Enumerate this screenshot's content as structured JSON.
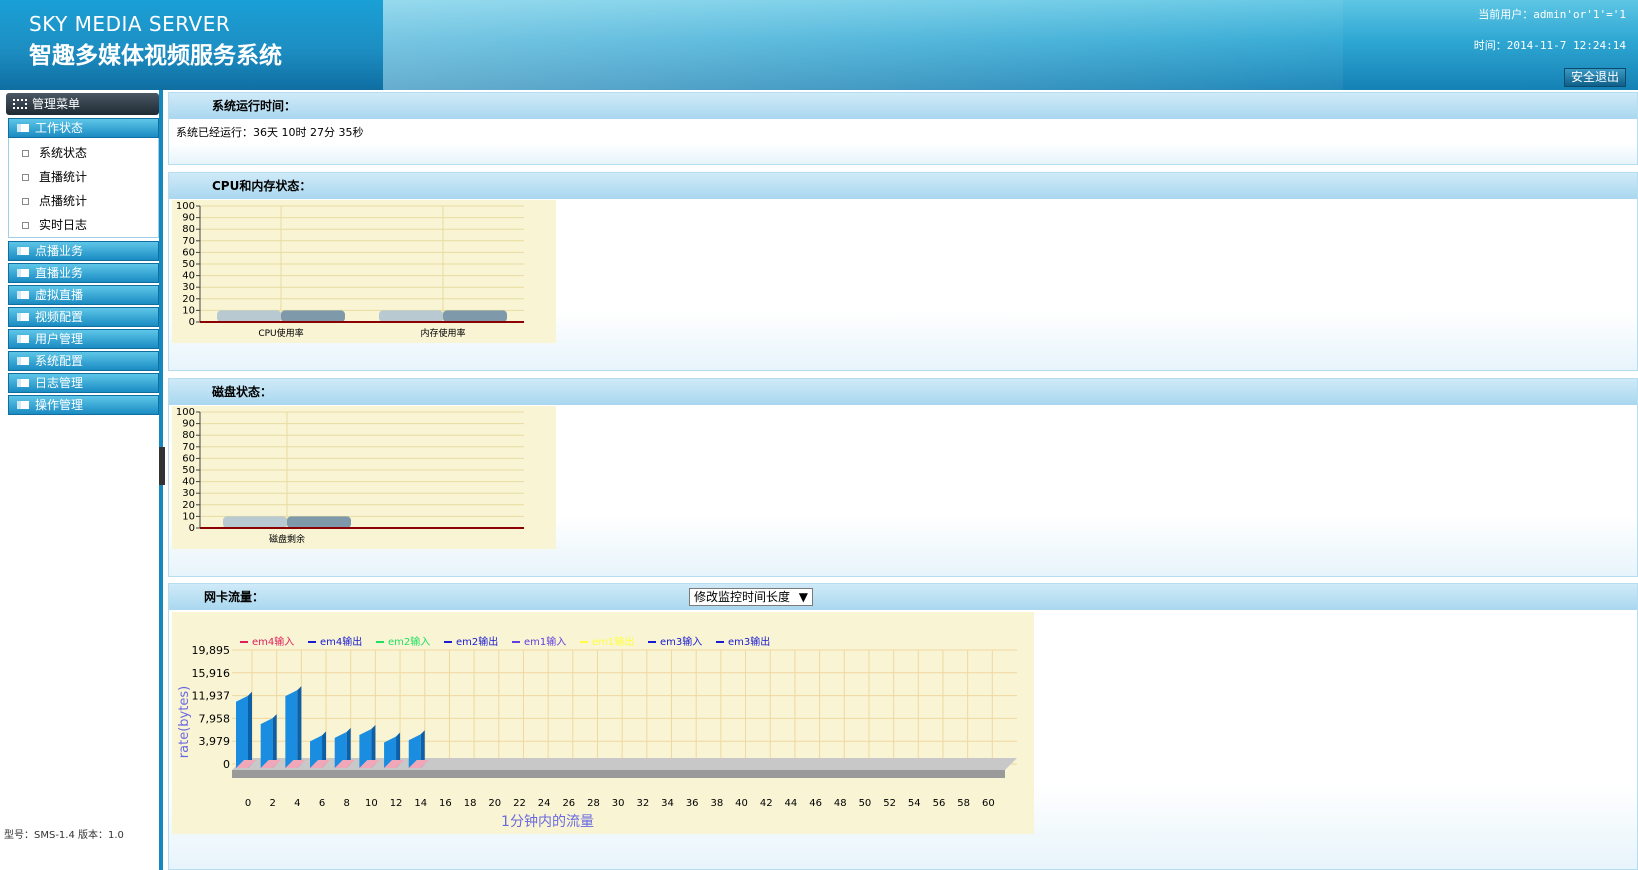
{
  "header": {
    "brand_en": "SKY MEDIA SERVER",
    "brand_cn": "智趣多媒体视频服务系统",
    "user_label": "当前用户：admin'or'1'='1",
    "time_label": "时间：2014-11-7 12:24:14",
    "logout": "安全退出"
  },
  "sidebar": {
    "title": "管理菜单",
    "groups": [
      "工作状态",
      "点播业务",
      "直播业务",
      "虚拟直播",
      "视频配置",
      "用户管理",
      "系统配置",
      "日志管理",
      "操作管理"
    ],
    "subitems": [
      "系统状态",
      "直播统计",
      "点播统计",
      "实时日志"
    ],
    "footer": "型号：SMS-1.4  版本：1.0"
  },
  "panels": {
    "uptime_title": "系统运行时间：",
    "uptime_text": "系统已经运行：36天 10时 27分 35秒",
    "cpu_title": "CPU和内存状态：",
    "disk_title": "磁盘状态：",
    "net_title": "网卡流量：",
    "select_label": "修改监控时间长度"
  },
  "colors": {
    "accent": "#1588be",
    "chart_bg": "#f8f4d4",
    "axis": "#8b0000"
  },
  "chart_data": [
    {
      "type": "bar",
      "categories": [
        "CPU使用率",
        "内存使用率"
      ],
      "values": [
        10,
        10
      ],
      "ylim": [
        0,
        100
      ],
      "yticks": [
        0,
        10,
        20,
        30,
        40,
        50,
        60,
        70,
        80,
        90,
        100
      ],
      "xlabel": "",
      "ylabel": ""
    },
    {
      "type": "bar",
      "categories": [
        "磁盘剩余"
      ],
      "values": [
        10
      ],
      "ylim": [
        0,
        100
      ],
      "yticks": [
        0,
        10,
        20,
        30,
        40,
        50,
        60,
        70,
        80,
        90,
        100
      ],
      "xlabel": "",
      "ylabel": ""
    },
    {
      "type": "bar",
      "legend": "top",
      "xlabel": "1分钟内的流量",
      "ylabel": "rate(bytes)",
      "yticks": [
        0,
        3979,
        7958,
        11937,
        15916,
        19895
      ],
      "ytick_labels": [
        "0",
        "3,979",
        "7,958",
        "11,937",
        "15,916",
        "19,895"
      ],
      "ylim": [
        0,
        19895
      ],
      "xticks": [
        0,
        2,
        4,
        6,
        8,
        10,
        12,
        14,
        16,
        18,
        20,
        22,
        24,
        26,
        28,
        30,
        32,
        34,
        36,
        38,
        40,
        42,
        44,
        46,
        48,
        50,
        52,
        54,
        56,
        58,
        60
      ],
      "series": [
        {
          "name": "em4输入",
          "color": "#e0205a"
        },
        {
          "name": "em4输出",
          "color": "#1a1ad0"
        },
        {
          "name": "em2输入",
          "color": "#20e060"
        },
        {
          "name": "em2输出",
          "color": "#1a1ad0"
        },
        {
          "name": "em1输入",
          "color": "#6040e0"
        },
        {
          "name": "em1输出",
          "color": "#ffff40"
        },
        {
          "name": "em3输入",
          "color": "#1a1ad0"
        },
        {
          "name": "em3输出",
          "color": "#1a1ad0"
        }
      ],
      "bars": {
        "x": [
          0,
          2,
          4,
          6,
          8,
          10,
          12,
          14
        ],
        "values": [
          11900,
          8000,
          12900,
          5000,
          5600,
          6100,
          4800,
          5200
        ]
      }
    }
  ]
}
